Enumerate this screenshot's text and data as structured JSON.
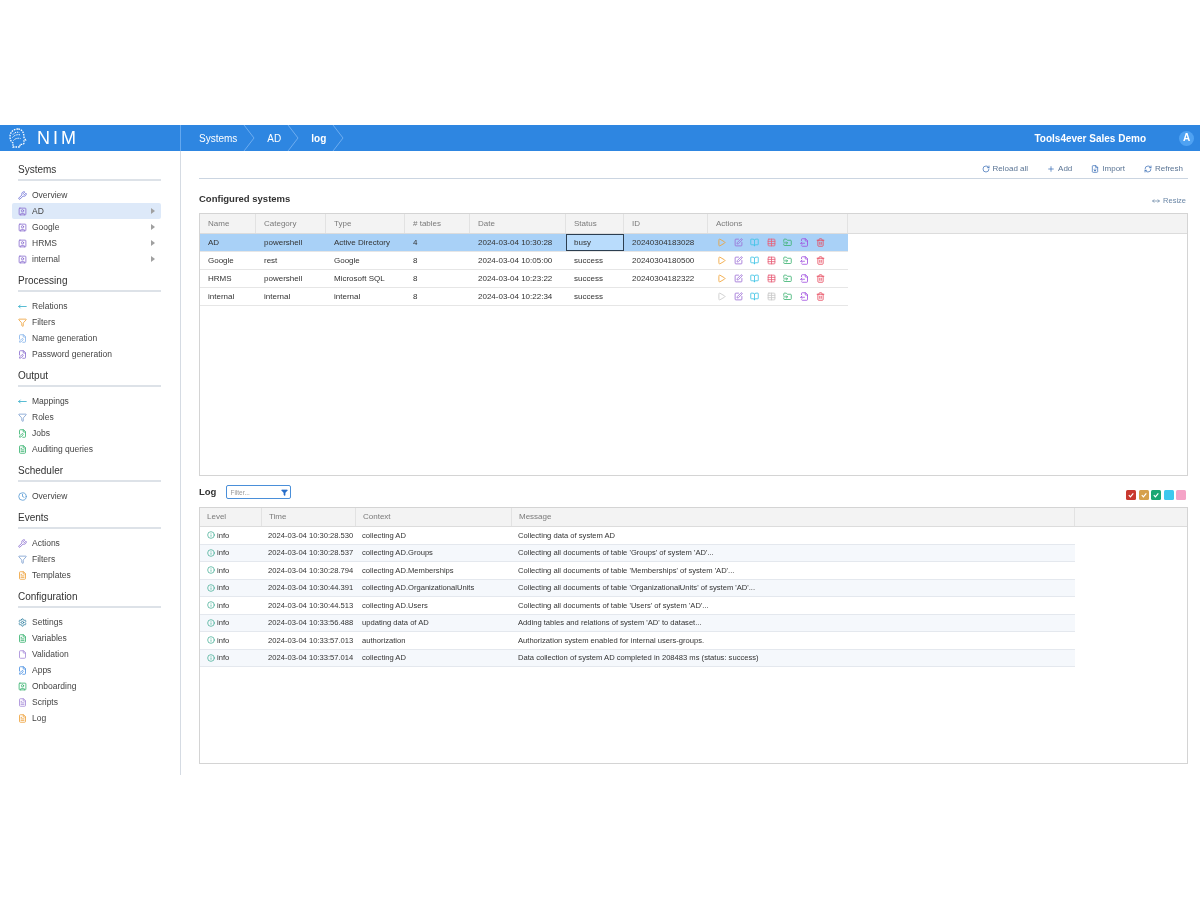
{
  "header": {
    "logo": "NIM",
    "breadcrumbs": [
      {
        "label": "Systems",
        "current": false
      },
      {
        "label": "AD",
        "current": false
      },
      {
        "label": "log",
        "current": true
      }
    ],
    "organization": "Tools4ever Sales Demo",
    "avatar": "A"
  },
  "sidebar": {
    "sections": [
      {
        "title": "Systems",
        "items": [
          {
            "label": "Overview",
            "selected": false,
            "expandable": false
          },
          {
            "label": "AD",
            "selected": true,
            "expandable": true
          },
          {
            "label": "Google",
            "selected": false,
            "expandable": true
          },
          {
            "label": "HRMS",
            "selected": false,
            "expandable": true
          },
          {
            "label": "internal",
            "selected": false,
            "expandable": true
          }
        ]
      },
      {
        "title": "Processing",
        "items": [
          {
            "label": "Relations",
            "selected": false,
            "expandable": false
          },
          {
            "label": "Filters",
            "selected": false,
            "expandable": false
          },
          {
            "label": "Name generation",
            "selected": false,
            "expandable": false
          },
          {
            "label": "Password generation",
            "selected": false,
            "expandable": false
          }
        ]
      },
      {
        "title": "Output",
        "items": [
          {
            "label": "Mappings",
            "selected": false,
            "expandable": false
          },
          {
            "label": "Roles",
            "selected": false,
            "expandable": false
          },
          {
            "label": "Jobs",
            "selected": false,
            "expandable": false
          },
          {
            "label": "Auditing queries",
            "selected": false,
            "expandable": false
          }
        ]
      },
      {
        "title": "Scheduler",
        "items": [
          {
            "label": "Overview",
            "selected": false,
            "expandable": false
          }
        ]
      },
      {
        "title": "Events",
        "items": [
          {
            "label": "Actions",
            "selected": false,
            "expandable": false
          },
          {
            "label": "Filters",
            "selected": false,
            "expandable": false
          },
          {
            "label": "Templates",
            "selected": false,
            "expandable": false
          }
        ]
      },
      {
        "title": "Configuration",
        "items": [
          {
            "label": "Settings",
            "selected": false,
            "expandable": false
          },
          {
            "label": "Variables",
            "selected": false,
            "expandable": false
          },
          {
            "label": "Validation",
            "selected": false,
            "expandable": false
          },
          {
            "label": "Apps",
            "selected": false,
            "expandable": false
          },
          {
            "label": "Onboarding",
            "selected": false,
            "expandable": false
          },
          {
            "label": "Scripts",
            "selected": false,
            "expandable": false
          },
          {
            "label": "Log",
            "selected": false,
            "expandable": false
          }
        ]
      }
    ]
  },
  "toolbar": {
    "buttons": [
      "Reload all",
      "Add",
      "Import",
      "Refresh"
    ]
  },
  "systems": {
    "title": "Configured systems",
    "resize": "Resize",
    "columns": [
      "Name",
      "Category",
      "Type",
      "# tables",
      "Date",
      "Status",
      "ID",
      "Actions"
    ],
    "rows": [
      {
        "name": "AD",
        "category": "powershell",
        "type": "Active Directory",
        "tables": "4",
        "date": "2024-03-04 10:30:28",
        "status": "busy",
        "status_focused": true,
        "id": "20240304183028",
        "selected": true,
        "actions": [
          {
            "disabled": false
          },
          {
            "disabled": false
          },
          {
            "disabled": false
          },
          {
            "disabled": false
          },
          {
            "disabled": false
          },
          {
            "disabled": false
          },
          {
            "disabled": false
          }
        ]
      },
      {
        "name": "Google",
        "category": "rest",
        "type": "Google",
        "tables": "8",
        "date": "2024-03-04 10:05:00",
        "status": "success",
        "status_focused": false,
        "id": "20240304180500",
        "selected": false,
        "actions": [
          {
            "disabled": false
          },
          {
            "disabled": false
          },
          {
            "disabled": false
          },
          {
            "disabled": false
          },
          {
            "disabled": false
          },
          {
            "disabled": false
          },
          {
            "disabled": false
          }
        ]
      },
      {
        "name": "HRMS",
        "category": "powershell",
        "type": "Microsoft SQL",
        "tables": "8",
        "date": "2024-03-04 10:23:22",
        "status": "success",
        "status_focused": false,
        "id": "20240304182322",
        "selected": false,
        "actions": [
          {
            "disabled": false
          },
          {
            "disabled": false
          },
          {
            "disabled": false
          },
          {
            "disabled": false
          },
          {
            "disabled": false
          },
          {
            "disabled": false
          },
          {
            "disabled": false
          }
        ]
      },
      {
        "name": "internal",
        "category": "internal",
        "type": "internal",
        "tables": "8",
        "date": "2024-03-04 10:22:34",
        "status": "success",
        "status_focused": false,
        "selected": false,
        "actions": [
          {
            "disabled": true
          },
          {
            "disabled": false
          },
          {
            "disabled": false
          },
          {
            "disabled": true
          },
          {
            "disabled": false
          },
          {
            "disabled": false
          },
          {
            "disabled": false
          }
        ]
      }
    ]
  },
  "log": {
    "title": "Log",
    "filter": {
      "placeholder": "Filter..."
    },
    "level_filters": [
      {
        "color": "#c8382f",
        "checked": true
      },
      {
        "color": "#d6a04c",
        "checked": true
      },
      {
        "color": "#1aa773",
        "checked": true
      },
      {
        "color": "#3ec8ee",
        "checked": false
      },
      {
        "color": "#f5a3c7",
        "checked": false
      }
    ],
    "columns": [
      "Level",
      "Time",
      "Context",
      "Message"
    ],
    "rows": [
      {
        "level": "info",
        "time": "2024-03-04 10:30:28.530",
        "context": "collecting AD",
        "message": "Collecting data of system AD"
      },
      {
        "level": "info",
        "time": "2024-03-04 10:30:28.537",
        "context": "collecting AD.Groups",
        "message": "Collecting all documents of table 'Groups' of system 'AD'..."
      },
      {
        "level": "info",
        "time": "2024-03-04 10:30:28.794",
        "context": "collecting AD.Memberships",
        "message": "Collecting all documents of table 'Memberships' of system 'AD'..."
      },
      {
        "level": "info",
        "time": "2024-03-04 10:30:44.391",
        "context": "collecting AD.OrganizationalUnits",
        "message": "Collecting all documents of table 'OrganizationalUnits' of system 'AD'..."
      },
      {
        "level": "info",
        "time": "2024-03-04 10:30:44.513",
        "context": "collecting AD.Users",
        "message": "Collecting all documents of table 'Users' of system 'AD'..."
      },
      {
        "level": "info",
        "time": "2024-03-04 10:33:56.488",
        "context": "updating data of AD",
        "message": "Adding tables and relations of system 'AD' to dataset..."
      },
      {
        "level": "info",
        "time": "2024-03-04 10:33:57.013",
        "context": "authorization",
        "message": "Authorization system enabled for internal users-groups."
      },
      {
        "level": "info",
        "time": "2024-03-04 10:33:57.014",
        "context": "collecting AD",
        "message": "Data collection of system AD completed in 208483 ms (status: success)"
      }
    ]
  }
}
